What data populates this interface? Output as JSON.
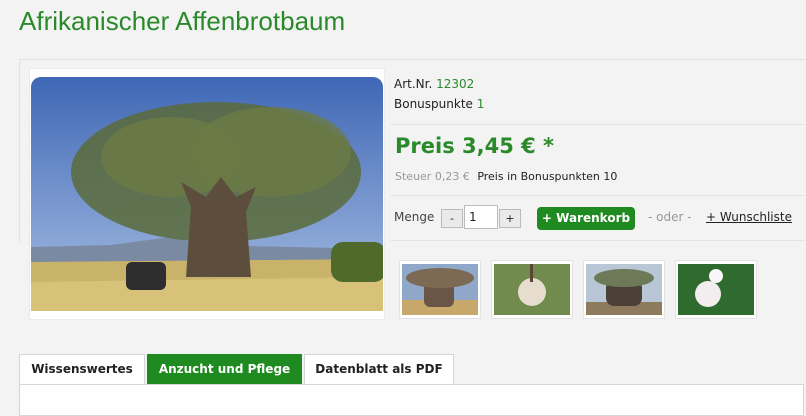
{
  "product": {
    "title": "Afrikanischer Affenbrotbaum",
    "art_label": "Art.Nr.",
    "art_value": "12302",
    "bonus_label": "Bonuspunkte",
    "bonus_value": "1",
    "price": "Preis 3,45 € *",
    "tax": "Steuer 0,23 €",
    "points_price": "Preis in Bonuspunkten 10"
  },
  "quantity": {
    "label": "Menge",
    "minus": "-",
    "value": "1",
    "plus": "+"
  },
  "actions": {
    "cart": "+ Warenkorb",
    "or": "- oder -",
    "wishlist": "+ Wunschliste"
  },
  "tabs": [
    {
      "label": "Wissenswertes",
      "active": false
    },
    {
      "label": "Anzucht und Pflege",
      "active": true
    },
    {
      "label": "Datenblatt als PDF",
      "active": false
    }
  ],
  "colors": {
    "brand_green": "#1f8a1f",
    "title_green": "#2a8a2a"
  }
}
